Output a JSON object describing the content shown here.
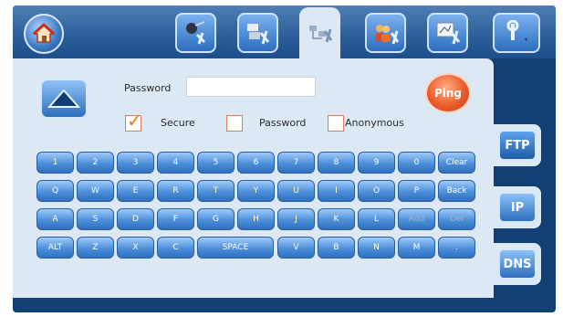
{
  "tabs": [
    {
      "name": "tab-network-tools",
      "icon": "satellite-tools-icon"
    },
    {
      "name": "tab-server-tools",
      "icon": "server-tools-icon"
    },
    {
      "name": "tab-network-settings",
      "icon": "network-tools-icon",
      "active": true
    },
    {
      "name": "tab-users",
      "icon": "users-tools-icon"
    },
    {
      "name": "tab-display",
      "icon": "display-tools-icon"
    },
    {
      "name": "tab-settings",
      "icon": "wrench-icon"
    }
  ],
  "form": {
    "password_label": "Password",
    "password_value": "",
    "ping_label": "Ping",
    "options": [
      {
        "label": "Secure",
        "checked": true
      },
      {
        "label": "Password",
        "checked": false
      },
      {
        "label": "Anonymous",
        "checked": false
      }
    ]
  },
  "keyboard": {
    "row1": [
      "1",
      "2",
      "3",
      "4",
      "5",
      "6",
      "7",
      "8",
      "9",
      "0",
      "Clear"
    ],
    "row2": [
      "Q",
      "W",
      "E",
      "R",
      "T",
      "Y",
      "U",
      "I",
      "O",
      "P",
      "Back"
    ],
    "row3": [
      "A",
      "S",
      "D",
      "F",
      "G",
      "H",
      "J",
      "K",
      "L",
      "Add",
      "Del"
    ],
    "row4": [
      "ALT",
      "Z",
      "X",
      "C",
      "SPACE",
      "V",
      "B",
      "N",
      "M",
      "."
    ]
  },
  "side_tabs": [
    "FTP",
    "IP",
    "DNS"
  ],
  "colors": {
    "frame": "#123f74",
    "panel": "#dde8f5",
    "ping": "#ec5c2b",
    "key": "#4c8ed9",
    "check": "#f07a1a"
  }
}
